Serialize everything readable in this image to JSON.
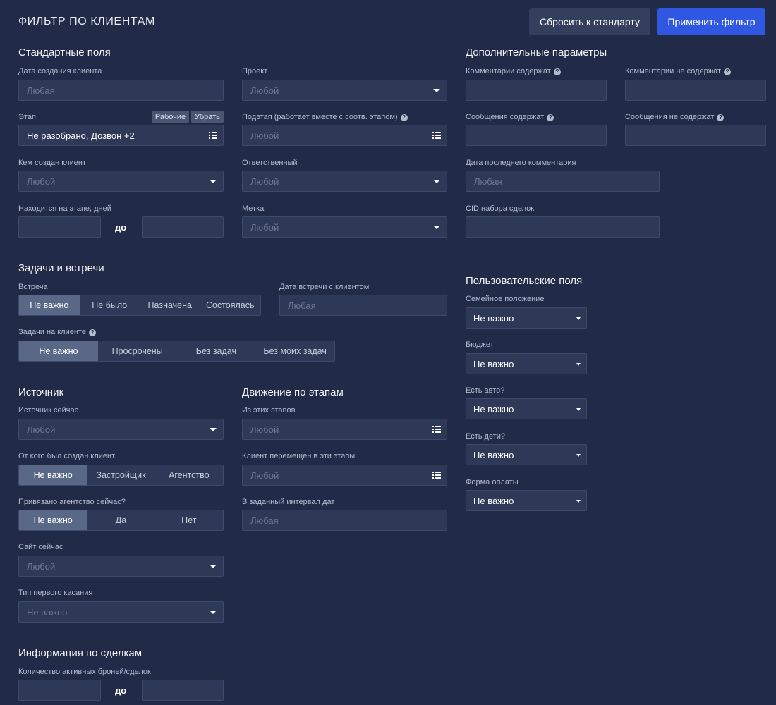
{
  "header": {
    "title": "ФИЛЬТР ПО КЛИЕНТАМ",
    "reset_label": "Сбросить к стандарту",
    "apply_label": "Применить фильтр"
  },
  "standard": {
    "title": "Стандартные поля",
    "created_date": {
      "label": "Дата создания клиента",
      "placeholder": "Любая"
    },
    "project": {
      "label": "Проект",
      "placeholder": "Любой"
    },
    "stage": {
      "label": "Этап",
      "value": "Не разобрано, Дозвон +2",
      "tag_working": "Рабочие",
      "tag_remove": "Убрать"
    },
    "substage": {
      "label": "Подэтап (работает вместе с соотв. этапом)",
      "placeholder": "Любой"
    },
    "created_by": {
      "label": "Кем создан клиент",
      "placeholder": "Любой"
    },
    "responsible": {
      "label": "Ответственный",
      "placeholder": "Любой"
    },
    "days_on_stage": {
      "label": "Находится на этапе, дней",
      "to_label": "до"
    },
    "mark": {
      "label": "Метка",
      "placeholder": "Любой"
    }
  },
  "extra": {
    "title": "Дополнительные параметры",
    "comments_contain": "Комментарии содержат",
    "comments_not_contain": "Комментарии не содержат",
    "messages_contain": "Сообщения содержат",
    "messages_not_contain": "Сообщения не содержат",
    "last_comment_date": {
      "label": "Дата последнего комментария",
      "placeholder": "Любая"
    },
    "cid": {
      "label": "CID набора сделок"
    }
  },
  "tasks": {
    "title": "Задачи и встречи",
    "meeting": {
      "label": "Встреча",
      "options": [
        "Не важно",
        "Не было",
        "Назначена",
        "Состоялась"
      ],
      "selected": 0
    },
    "meeting_date": {
      "label": "Дата встречи с клиентом",
      "placeholder": "Любая"
    },
    "client_tasks": {
      "label": "Задачи на клиенте",
      "options": [
        "Не важно",
        "Просрочены",
        "Без задач",
        "Без моих задач"
      ],
      "selected": 0
    }
  },
  "source": {
    "title": "Источник",
    "current": {
      "label": "Источник сейчас",
      "placeholder": "Любой"
    },
    "created_from": {
      "label": "От кого был создан клиент",
      "options": [
        "Не важно",
        "Застройщик",
        "Агентство"
      ],
      "selected": 0
    },
    "agency_bound": {
      "label": "Привязано агентство сейчас?",
      "options": [
        "Не важно",
        "Да",
        "Нет"
      ],
      "selected": 0
    },
    "site": {
      "label": "Сайт сейчас",
      "placeholder": "Любой"
    },
    "first_touch": {
      "label": "Тип первого касания",
      "placeholder": "Не важно"
    }
  },
  "movement": {
    "title": "Движение по этапам",
    "from_stages": {
      "label": "Из этих этапов",
      "placeholder": "Любой"
    },
    "moved_to": {
      "label": "Клиент перемещен в эти этапы",
      "placeholder": "Любой"
    },
    "interval": {
      "label": "В заданный интервал дат",
      "placeholder": "Любая"
    }
  },
  "custom": {
    "title": "Пользовательские поля",
    "fields": [
      {
        "label": "Семейное положение",
        "value": "Не важно"
      },
      {
        "label": "Бюджет",
        "value": "Не важно"
      },
      {
        "label": "Есть авто?",
        "value": "Не важно"
      },
      {
        "label": "Есть дети?",
        "value": "Не важно"
      },
      {
        "label": "Форма оплаты",
        "value": "Не важно"
      }
    ]
  },
  "deals": {
    "title": "Информация по сделкам",
    "active_count": {
      "label": "Количество активных броней/сделок",
      "to_label": "до"
    }
  }
}
